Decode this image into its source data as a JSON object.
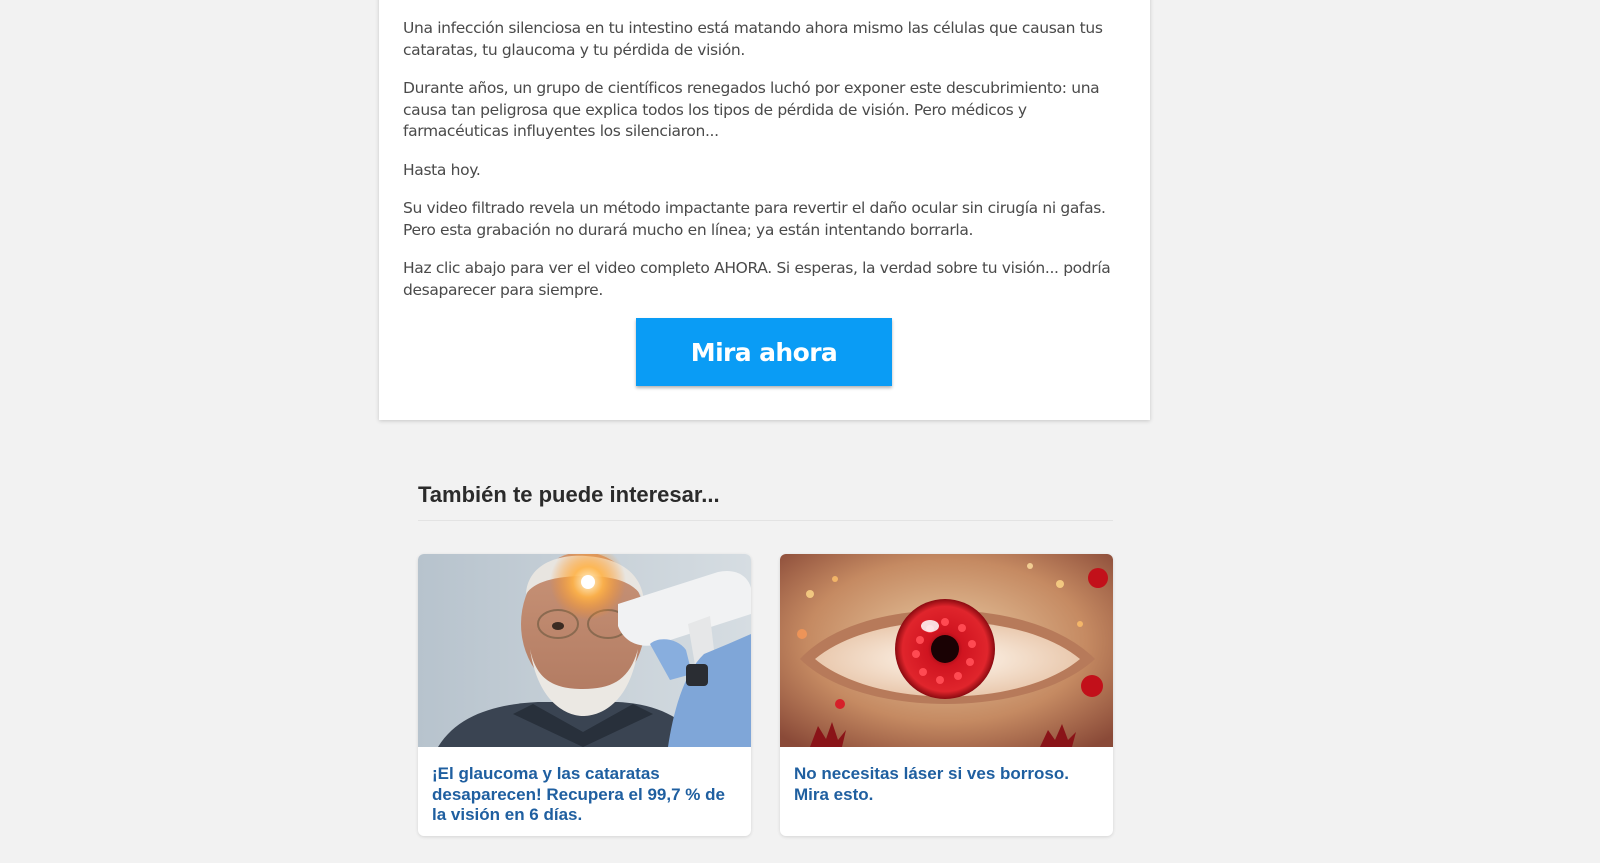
{
  "article": {
    "paragraphs": [
      "Una infección silenciosa en tu intestino está matando ahora mismo las células que causan tus cataratas, tu glaucoma y tu pérdida de visión.",
      "Durante años, un grupo de científicos renegados luchó por exponer este descubrimiento: una causa tan peligrosa que explica todos los tipos de pérdida de visión. Pero médicos y farmacéuticas influyentes los silenciaron...",
      "Hasta hoy.",
      "Su video filtrado revela un método impactante para revertir el daño ocular sin cirugía ni gafas. Pero esta grabación no durará mucho en línea; ya están intentando borrarla.",
      "Haz clic abajo para ver el video completo AHORA. Si esperas, la verdad sobre tu visión... podría desaparecer para siempre."
    ],
    "cta_label": "Mira ahora"
  },
  "related": {
    "heading": "También te puede interesar...",
    "cards": [
      {
        "title": "¡El glaucoma y las cataratas desaparecen! Recupera el 99,7 % de la visión en 6 días.",
        "image": "older-man-eye-exam-photo"
      },
      {
        "title": "No necesitas láser si ves borroso. Mira esto.",
        "image": "red-pomegranate-eye-illustration"
      }
    ]
  },
  "colors": {
    "page_background": "#f2f2f2",
    "cta_background": "#0a9cf5",
    "card_title": "#1f5fa0",
    "body_text": "#4a4a4a"
  }
}
